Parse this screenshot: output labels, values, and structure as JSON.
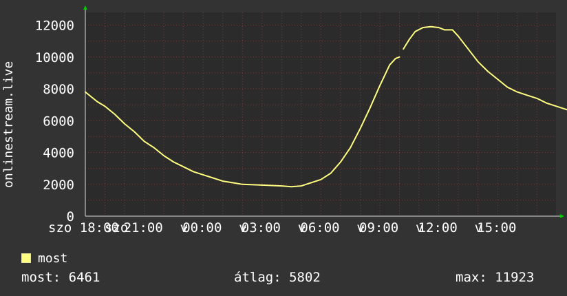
{
  "chart_data": {
    "type": "line",
    "ylabel": "onlinestream.live",
    "ylim": [
      0,
      12800
    ],
    "y_ticks": [
      "0",
      "2000",
      "4000",
      "6000",
      "8000",
      "10000",
      "12000"
    ],
    "x_tick_labels": [
      {
        "label": "szo 18:00",
        "overlap_label": "szo"
      },
      {
        "label": "21:00",
        "suffix": "v"
      },
      {
        "label": "00:00",
        "suffix": "v"
      },
      {
        "label": "03:00",
        "suffix": "v"
      },
      {
        "label": "06:00",
        "suffix": "v"
      },
      {
        "label": "09:00",
        "suffix": "v"
      },
      {
        "label": "12:00",
        "suffix": "v"
      },
      {
        "label": "15:00",
        "suffix": ""
      }
    ],
    "x_hours_range": [
      0,
      24
    ],
    "grid": true,
    "series": [
      {
        "name": "most",
        "color": "#ffff80",
        "points": [
          [
            0,
            7800
          ],
          [
            0.3,
            7500
          ],
          [
            0.6,
            7200
          ],
          [
            1.0,
            6900
          ],
          [
            1.5,
            6400
          ],
          [
            2.0,
            5800
          ],
          [
            2.5,
            5300
          ],
          [
            3.0,
            4700
          ],
          [
            3.5,
            4300
          ],
          [
            4.0,
            3800
          ],
          [
            4.5,
            3400
          ],
          [
            5.0,
            3100
          ],
          [
            5.5,
            2800
          ],
          [
            6.0,
            2600
          ],
          [
            6.5,
            2400
          ],
          [
            7.0,
            2200
          ],
          [
            7.5,
            2100
          ],
          [
            8.0,
            2000
          ],
          [
            9.0,
            1950
          ],
          [
            10.0,
            1900
          ],
          [
            10.5,
            1850
          ],
          [
            11.0,
            1900
          ],
          [
            11.5,
            2100
          ],
          [
            12.0,
            2300
          ],
          [
            12.5,
            2700
          ],
          [
            13.0,
            3400
          ],
          [
            13.5,
            4300
          ],
          [
            14.0,
            5500
          ],
          [
            14.5,
            6800
          ],
          [
            15.0,
            8200
          ],
          [
            15.5,
            9500
          ],
          [
            15.8,
            9900
          ],
          [
            16.0,
            10000
          ]
        ]
      },
      {
        "name": "most",
        "color": "#ffff80",
        "points": [
          [
            16.2,
            10500
          ],
          [
            16.5,
            11100
          ],
          [
            16.8,
            11600
          ],
          [
            17.2,
            11850
          ],
          [
            17.6,
            11900
          ],
          [
            18.0,
            11850
          ],
          [
            18.3,
            11700
          ],
          [
            18.7,
            11700
          ],
          [
            19.0,
            11300
          ],
          [
            19.5,
            10500
          ],
          [
            20.0,
            9700
          ],
          [
            20.5,
            9100
          ],
          [
            21.0,
            8600
          ],
          [
            21.5,
            8100
          ],
          [
            22.0,
            7800
          ],
          [
            22.5,
            7600
          ],
          [
            23.0,
            7400
          ],
          [
            23.5,
            7100
          ],
          [
            24.0,
            6900
          ],
          [
            24.5,
            6700
          ],
          [
            25.0,
            6500
          ],
          [
            25.2,
            6461
          ]
        ]
      }
    ]
  },
  "legend": {
    "label": "most",
    "color": "#ffff80"
  },
  "stats": {
    "most": "most: 6461",
    "atlag": "átlag: 5802",
    "max": "max: 11923"
  },
  "colors": {
    "background": "#333333",
    "plot_background": "#2b2b2b",
    "grid": "#704040",
    "axis": "#dddddd",
    "arrow": "#00cc00",
    "text": "#ffffff"
  }
}
